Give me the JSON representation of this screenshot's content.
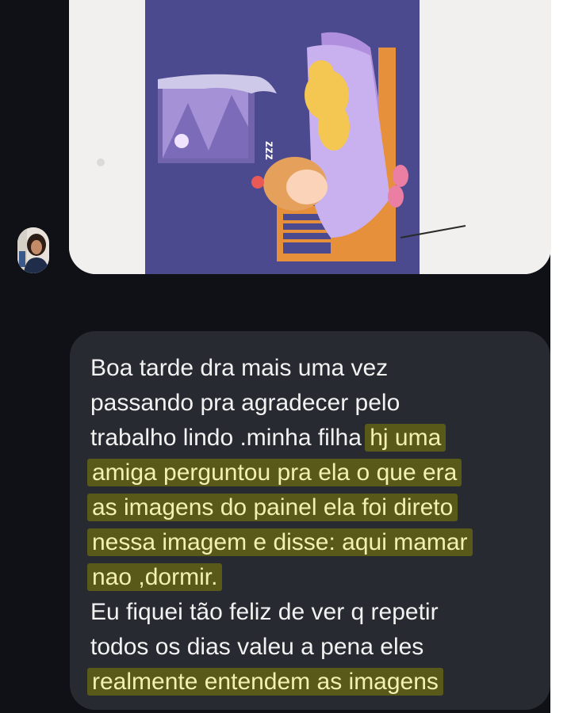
{
  "chat": {
    "sender_avatar": "contact-avatar-photo",
    "image_message": {
      "description_icon": "bedtime-illustration",
      "sleep_text": "zzz"
    },
    "text_message": {
      "lines": [
        {
          "plain": "Boa tarde dra mais uma vez",
          "highlight": ""
        },
        {
          "plain": "passando pra agradecer pelo",
          "highlight": ""
        },
        {
          "plain": "trabalho lindo .minha filha ",
          "highlight": "hj uma"
        },
        {
          "plain": "",
          "highlight": "amiga perguntou pra ela o que era"
        },
        {
          "plain": "",
          "highlight": "as imagens do painel ela foi direto"
        },
        {
          "plain": "",
          "highlight": "nessa imagem e disse: aqui mamar"
        },
        {
          "plain": "",
          "highlight": "nao ,dormir."
        },
        {
          "plain": "Eu fiquei tão feliz de ver q repetir",
          "highlight": ""
        },
        {
          "plain": "todos os dias valeu a pena eles",
          "highlight": ""
        },
        {
          "plain": "",
          "highlight": "realmente entendem as imagens"
        }
      ]
    }
  },
  "colors": {
    "background": "#0f1117",
    "bubble": "#272a30",
    "text": "#f2f2f2",
    "highlight": "#59591a"
  }
}
